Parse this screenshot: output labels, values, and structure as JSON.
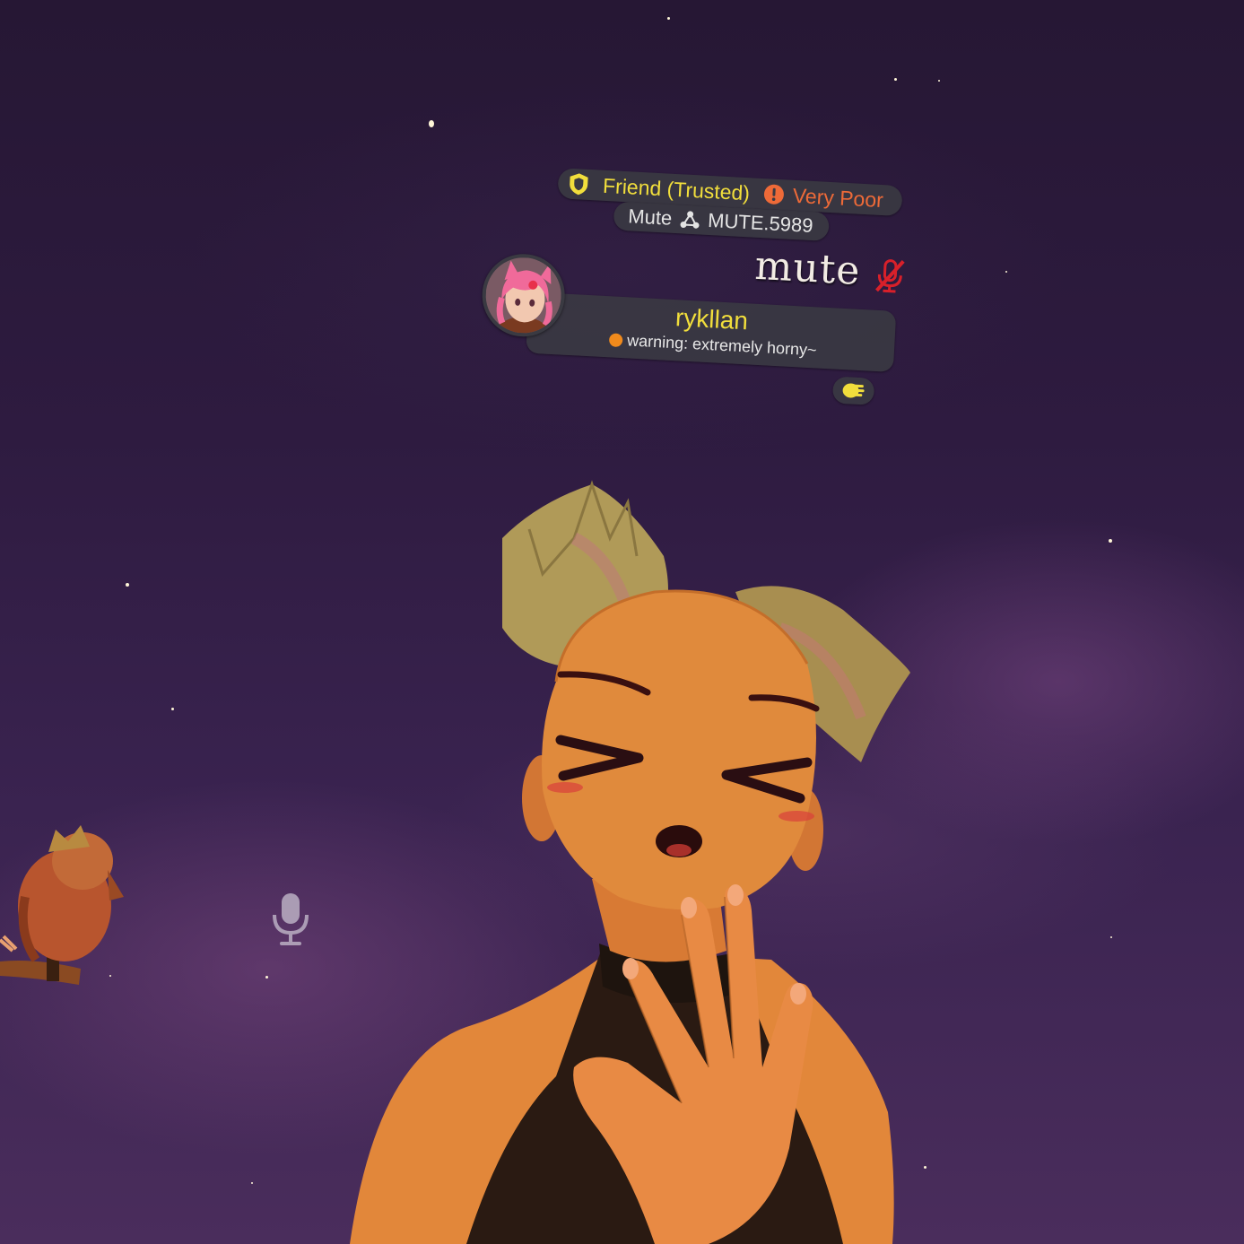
{
  "nameplate": {
    "trust_label": "Friend (Trusted)",
    "performance_label": "Very Poor",
    "mute_label": "Mute",
    "mute_id": "MUTE.5989",
    "big_mute_label": "mute",
    "display_name": "rykllan",
    "status_text": "warning: extremely horny~",
    "colors": {
      "trust": "#f1de3c",
      "performance": "#ee6a38",
      "status_dot": "#f08a1c",
      "muted_icon": "#d8202a"
    },
    "icons": [
      "shield-icon",
      "warning-icon",
      "network-icon",
      "muted-mic-icon",
      "hand-gesture-icon"
    ]
  },
  "hud": {
    "icons": [
      "microphone-icon"
    ]
  }
}
